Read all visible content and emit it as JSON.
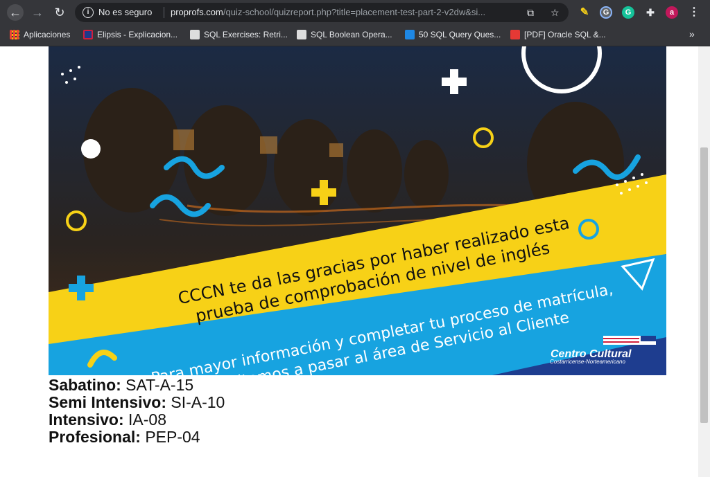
{
  "browser": {
    "security_label": "No es seguro",
    "url_host": "proprofs.com",
    "url_path": "/quiz-school/quizreport.php?title=placement-test-part-2-v2dw&si...",
    "profile_initial": "a",
    "bookmarks": [
      {
        "label": "Aplicaciones",
        "icon": "apps-grid-icon"
      },
      {
        "label": "Elipsis - Explicacion...",
        "icon": "uk-flag-icon"
      },
      {
        "label": "SQL Exercises: Retri...",
        "icon": "w3r-icon"
      },
      {
        "label": "SQL Boolean Opera...",
        "icon": "w3r-icon"
      },
      {
        "label": "50 SQL Query Ques...",
        "icon": "tb-icon"
      },
      {
        "label": "[PDF] Oracle SQL &...",
        "icon": "pdf-icon"
      }
    ],
    "more_bookmarks": "»"
  },
  "banner": {
    "line1": "CCCN te da las gracias por haber realizado esta",
    "line2": "prueba de comprobación de nivel de inglés",
    "line3": "Para mayor información y completar tu proceso de matrícula,",
    "line4": "te invitamos a pasar al área de Servicio al Cliente",
    "logo_title": "Centro Cultural",
    "logo_subtitle": "Costarricense-Norteamericano"
  },
  "schedule": [
    {
      "label": "Sabatino:",
      "code": "SAT-A-15"
    },
    {
      "label": "Semi Intensivo:",
      "code": "SI-A-10"
    },
    {
      "label": "Intensivo:",
      "code": "IA-08"
    },
    {
      "label": "Profesional:",
      "code": "PEP-04"
    }
  ],
  "colors": {
    "yellow": "#f7d117",
    "blue": "#17a3e0",
    "navy": "#1e3d8f"
  }
}
